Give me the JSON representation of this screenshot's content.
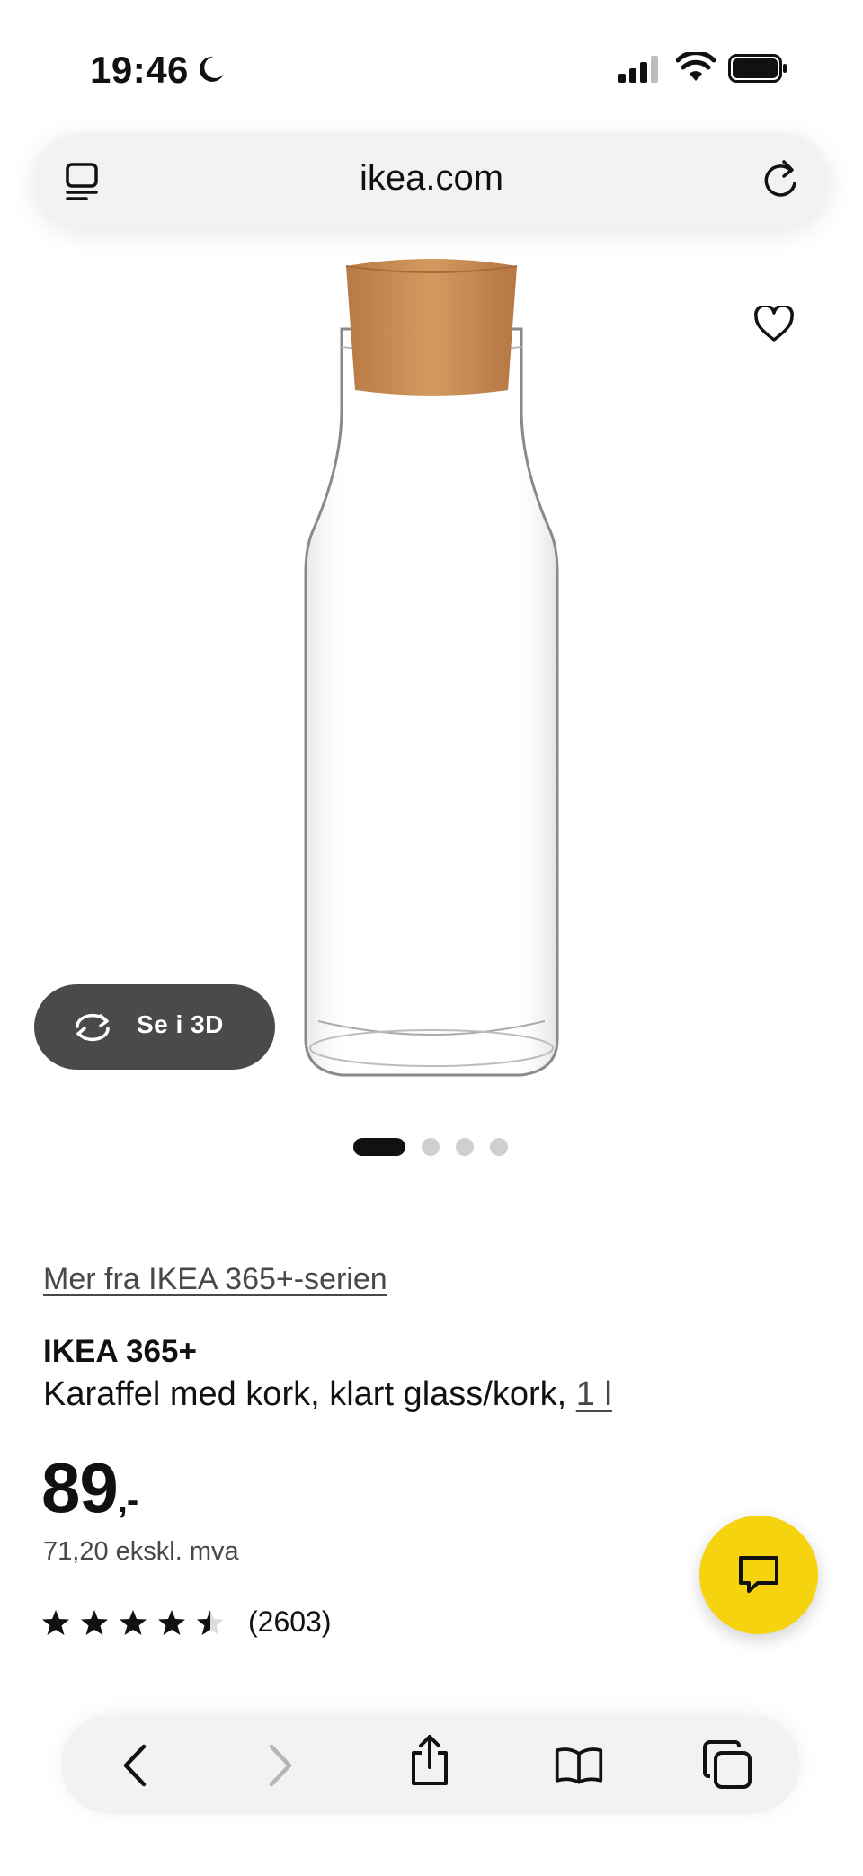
{
  "status_bar": {
    "time": "19:46",
    "icons": [
      "moon-icon",
      "cellular-signal-icon",
      "wifi-icon",
      "battery-icon"
    ]
  },
  "browser": {
    "url": "ikea.com",
    "icons": [
      "reader-mode-icon",
      "reload-icon"
    ]
  },
  "gallery": {
    "view_3d_label": "Se i 3D",
    "slide_count": 4,
    "active_slide": 1
  },
  "product": {
    "series_link": "Mer fra IKEA 365+-serien",
    "name": "IKEA 365+",
    "description": "Karaffel med kork, klart glass/kork, ",
    "size": "1 l",
    "price_main": "89",
    "price_suffix": ",-",
    "price_ex_vat": "71,20 ekskl. mva",
    "rating_value": 4.5,
    "rating_max": 5,
    "review_count": "(2603)"
  },
  "colors": {
    "accent_yellow": "#f5d40f",
    "dark_button": "#4a4a4a",
    "cork": "#c8894f"
  },
  "toolbar": {
    "icons": [
      "back-icon",
      "forward-icon",
      "share-icon",
      "bookmarks-icon",
      "tabs-icon"
    ]
  }
}
